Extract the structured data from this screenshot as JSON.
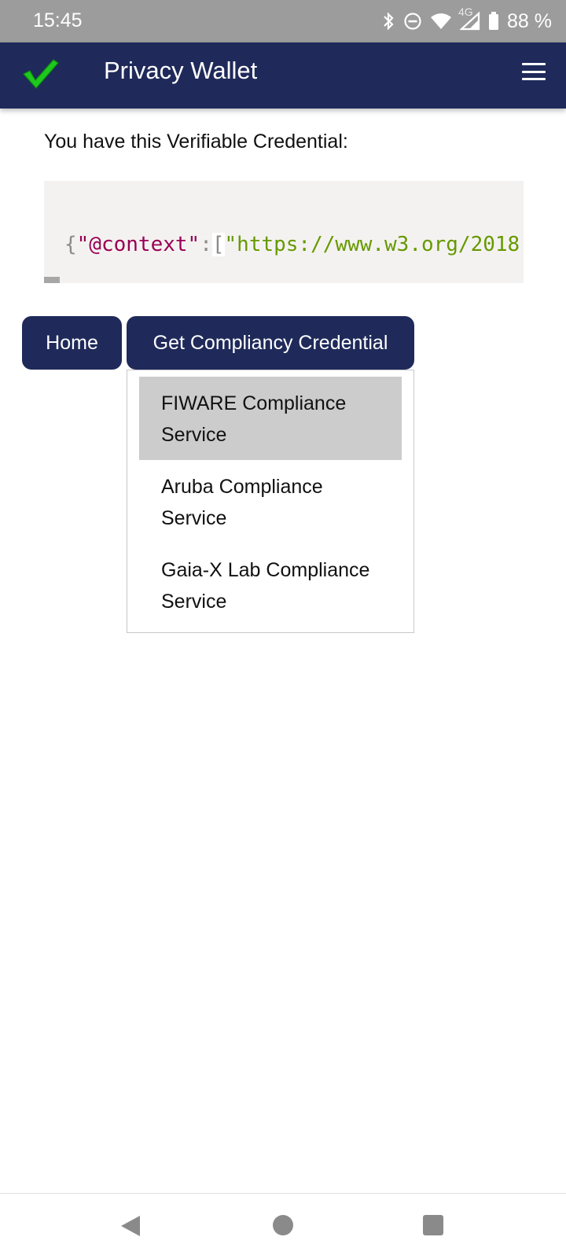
{
  "status_bar": {
    "time": "15:45",
    "network": "4G",
    "battery": "88 %",
    "icons": [
      "bluetooth-icon",
      "do-not-disturb-icon",
      "wifi-icon",
      "cell-signal-icon",
      "battery-icon"
    ]
  },
  "app_bar": {
    "title": "Privacy Wallet",
    "logo_icon": "checkmark-icon",
    "menu_icon": "hamburger-menu-icon",
    "background": "#1f2a5a"
  },
  "content": {
    "intro": "You have this Verifiable Credential:",
    "credential_snippet": {
      "open_brace": "{",
      "key": "\"@context\"",
      "colon": ":",
      "open_bracket": "[",
      "value": "\"https://www.w3.org/2018"
    }
  },
  "buttons": {
    "home": "Home",
    "get_compliancy": "Get Compliancy Credential"
  },
  "dropdown": {
    "items": [
      {
        "label": "FIWARE Compliance Service",
        "active": true
      },
      {
        "label": "Aruba Compliance Service",
        "active": false
      },
      {
        "label": "Gaia-X Lab Compliance Service",
        "active": false
      }
    ]
  },
  "nav_bar": {
    "icons": [
      "back-icon",
      "home-icon",
      "recent-apps-icon"
    ]
  }
}
